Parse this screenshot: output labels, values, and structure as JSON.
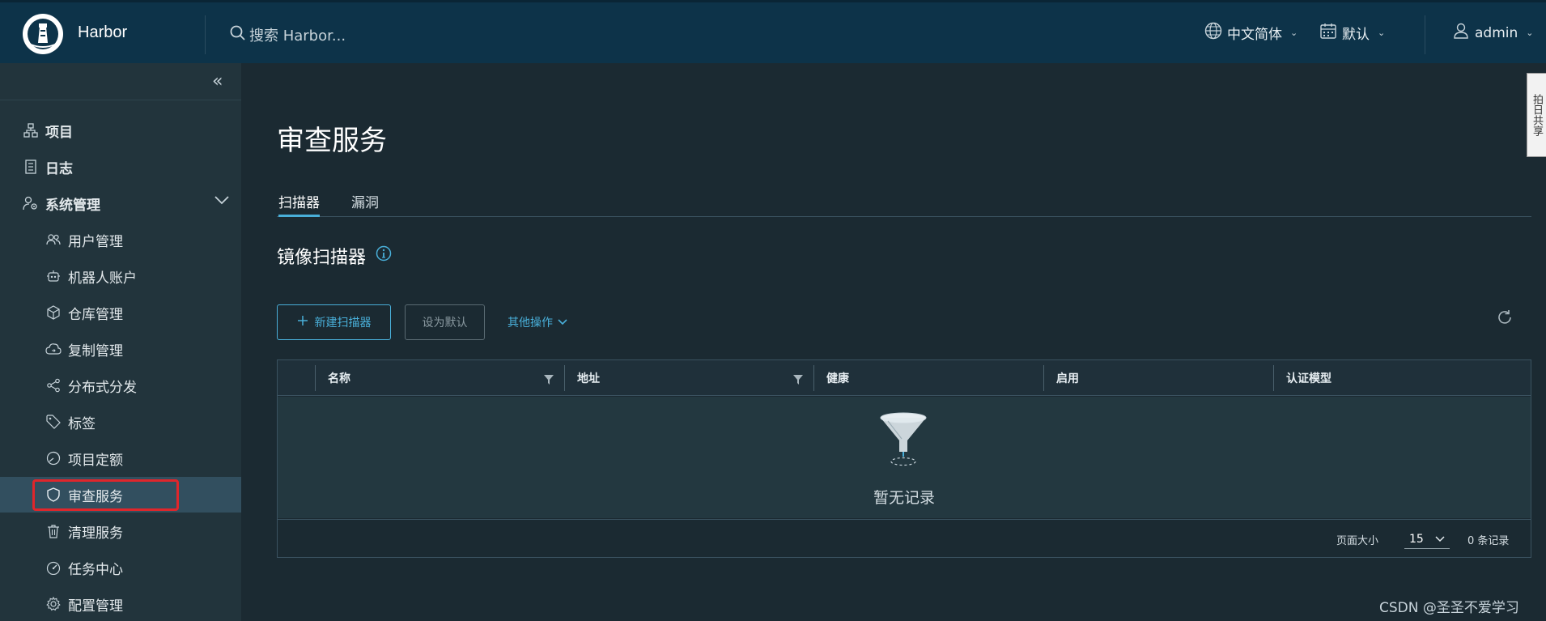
{
  "header": {
    "brand": "Harbor",
    "search_placeholder": "搜索 Harbor...",
    "language": "中文简体",
    "theme": "默认",
    "user": "admin"
  },
  "sidebar": {
    "items": [
      {
        "label": "项目",
        "icon": "projects-icon"
      },
      {
        "label": "日志",
        "icon": "logs-icon"
      },
      {
        "label": "系统管理",
        "icon": "system-admin-icon"
      }
    ],
    "admin_items": [
      {
        "label": "用户管理",
        "icon": "users-icon"
      },
      {
        "label": "机器人账户",
        "icon": "robot-icon"
      },
      {
        "label": "仓库管理",
        "icon": "registry-icon"
      },
      {
        "label": "复制管理",
        "icon": "replication-icon"
      },
      {
        "label": "分布式分发",
        "icon": "distribution-icon"
      },
      {
        "label": "标签",
        "icon": "tag-icon"
      },
      {
        "label": "项目定额",
        "icon": "quota-icon"
      },
      {
        "label": "审查服务",
        "icon": "shield-icon"
      },
      {
        "label": "清理服务",
        "icon": "trash-icon"
      },
      {
        "label": "任务中心",
        "icon": "dashboard-icon"
      },
      {
        "label": "配置管理",
        "icon": "gear-icon"
      }
    ],
    "active_item": "审查服务"
  },
  "main": {
    "title": "审查服务",
    "tabs": [
      {
        "label": "扫描器",
        "active": true
      },
      {
        "label": "漏洞",
        "active": false
      }
    ],
    "section_title": "镜像扫描器",
    "toolbar": {
      "new_scanner": "新建扫描器",
      "set_default": "设为默认",
      "other_actions": "其他操作"
    },
    "grid": {
      "columns": [
        "名称",
        "地址",
        "健康",
        "启用",
        "认证模型"
      ],
      "empty_text": "暂无记录",
      "page_size_label": "页面大小",
      "page_size": "15",
      "record_count": "0 条记录"
    }
  },
  "side_tab": "拍日共享",
  "watermark": "CSDN @圣圣不爱学习",
  "colors": {
    "header_bg": "#0d3349",
    "sidebar_bg": "#22343c",
    "main_bg": "#1b2a32",
    "accent": "#49afd9",
    "active_bg": "#324f5f",
    "highlight_red": "#e0262b"
  }
}
